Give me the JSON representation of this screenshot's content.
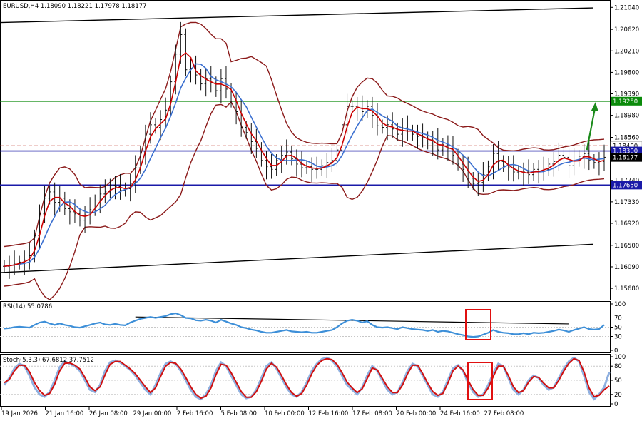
{
  "chart_data": {
    "type": "line",
    "header": "EURUSD,H4  1.18090 1.18221 1.17978 1.18177",
    "price_axis": {
      "ylim": [
        1.1545,
        1.2118
      ],
      "ticks": [
        "1.21040",
        "1.20620",
        "1.20210",
        "1.19800",
        "1.19390",
        "1.18980",
        "1.18560",
        "1.17740",
        "1.17330",
        "1.16920",
        "1.16500",
        "1.16090",
        "1.15680"
      ],
      "tick_values": [
        1.2104,
        1.2062,
        1.2021,
        1.198,
        1.1939,
        1.1898,
        1.1856,
        1.1774,
        1.1733,
        1.1692,
        1.165,
        1.1609,
        1.1568
      ]
    },
    "levels": [
      {
        "label": "1.19250",
        "value": 1.1925,
        "color": "#0a8a0a",
        "bg": "#0a8a0a",
        "fg": "#ffffff"
      },
      {
        "label": "1.18400",
        "value": 1.184,
        "color": "#c0392b",
        "bg": "#ffffff",
        "fg": "#000000",
        "dashed": true
      },
      {
        "label": "1.18300",
        "value": 1.183,
        "color": "#1a1aa8",
        "bg": "#1a1aa8",
        "fg": "#ffffff"
      },
      {
        "label": "1.18177",
        "value": 1.18177,
        "color": "#000000",
        "bg": "#000000",
        "fg": "#ffffff"
      },
      {
        "label": "1.17650",
        "value": 1.1765,
        "color": "#1a1aa8",
        "bg": "#1a1aa8",
        "fg": "#ffffff"
      }
    ],
    "x_axis": {
      "labels": [
        "19 Jan 2026",
        "21 Jan 16:00",
        "26 Jan 08:00",
        "29 Jan 00:00",
        "2 Feb 16:00",
        "5 Feb 08:00",
        "10 Feb 00:00",
        "12 Feb 16:00",
        "17 Feb 08:00",
        "20 Feb 00:00",
        "24 Feb 16:00",
        "27 Feb 08:00"
      ],
      "n_bars": 120
    },
    "price_series": [
      1.161,
      1.1612,
      1.1616,
      1.1618,
      1.1622,
      1.163,
      1.1668,
      1.171,
      1.174,
      1.1752,
      1.1732,
      1.174,
      1.172,
      1.1714,
      1.171,
      1.1698,
      1.1708,
      1.1718,
      1.1735,
      1.1748,
      1.1752,
      1.1765,
      1.1762,
      1.1755,
      1.1758,
      1.1768,
      1.1798,
      1.1828,
      1.1862,
      1.188,
      1.1875,
      1.189,
      1.1908,
      1.1962,
      1.2015,
      1.2052,
      1.1985,
      1.1988,
      1.1975,
      1.1958,
      1.1968,
      1.196,
      1.1945,
      1.1968,
      1.1948,
      1.1925,
      1.1905,
      1.1875,
      1.1865,
      1.1848,
      1.1835,
      1.1812,
      1.18,
      1.1795,
      1.1812,
      1.1822,
      1.1828,
      1.1815,
      1.1805,
      1.1798,
      1.18,
      1.1795,
      1.1795,
      1.1802,
      1.1808,
      1.1812,
      1.1832,
      1.188,
      1.1915,
      1.1915,
      1.1912,
      1.1905,
      1.1915,
      1.1898,
      1.1878,
      1.1875,
      1.188,
      1.1872,
      1.1862,
      1.1874,
      1.1868,
      1.1862,
      1.1858,
      1.1855,
      1.1845,
      1.185,
      1.1832,
      1.1842,
      1.1835,
      1.1822,
      1.1805,
      1.1795,
      1.1778,
      1.1768,
      1.177,
      1.1785,
      1.18,
      1.1825,
      1.181,
      1.1802,
      1.1798,
      1.179,
      1.1788,
      1.179,
      1.1785,
      1.1795,
      1.1792,
      1.1795,
      1.1805,
      1.181,
      1.1822,
      1.1818,
      1.1802,
      1.1812,
      1.182,
      1.1825,
      1.1812,
      1.1808,
      1.181,
      1.1818
    ],
    "overlays": [
      {
        "name": "fast MA",
        "color": "#cc0000"
      },
      {
        "name": "slow MA",
        "color": "#3a6fd0"
      },
      {
        "name": "Bollinger bands",
        "color": "#8b1a1a"
      }
    ],
    "trend_lines": [
      {
        "from": [
          0,
          1.2075
        ],
        "to": [
          119,
          1.2103
        ]
      },
      {
        "from": [
          0,
          1.1598
        ],
        "to": [
          119,
          1.1652
        ]
      }
    ],
    "arrow": {
      "from_bar": 115,
      "from_value": 1.1832,
      "to_bar": 116,
      "to_value": 1.1926,
      "color": "#1a8a1a"
    },
    "rsi": {
      "label": "RSI(14) 55.0786",
      "ylim": [
        0,
        100
      ],
      "ticks": [
        "100",
        "70",
        "50",
        "30",
        "0"
      ],
      "tick_values": [
        100,
        70,
        50,
        30,
        0
      ],
      "values": [
        47,
        48,
        50,
        51,
        50,
        49,
        55,
        60,
        62,
        58,
        55,
        58,
        55,
        53,
        50,
        49,
        52,
        55,
        58,
        60,
        56,
        55,
        57,
        55,
        54,
        60,
        64,
        68,
        70,
        72,
        70,
        72,
        74,
        78,
        80,
        76,
        70,
        69,
        65,
        64,
        66,
        64,
        60,
        66,
        62,
        58,
        55,
        50,
        48,
        45,
        43,
        40,
        38,
        38,
        40,
        42,
        44,
        41,
        40,
        39,
        40,
        38,
        38,
        40,
        42,
        44,
        50,
        58,
        64,
        66,
        64,
        60,
        63,
        55,
        50,
        49,
        50,
        48,
        46,
        50,
        48,
        46,
        45,
        44,
        42,
        44,
        40,
        42,
        41,
        38,
        35,
        33,
        30,
        29,
        30,
        34,
        38,
        44,
        40,
        38,
        37,
        35,
        35,
        37,
        35,
        38,
        37,
        38,
        40,
        42,
        45,
        43,
        40,
        44,
        47,
        50,
        46,
        45,
        46,
        55
      ],
      "trend_line": {
        "from": [
          26,
          72
        ],
        "to": [
          112,
          57
        ]
      }
    },
    "stochastic": {
      "label": "Stoch(5,3,3) 67.6812 37.7512",
      "ylim": [
        0,
        100
      ],
      "ticks": [
        "100",
        "80",
        "50",
        "20",
        "0"
      ],
      "tick_values": [
        100,
        80,
        50,
        20,
        0
      ],
      "main": [
        40,
        55,
        75,
        85,
        80,
        60,
        35,
        20,
        15,
        25,
        50,
        78,
        90,
        85,
        80,
        70,
        50,
        30,
        25,
        40,
        70,
        88,
        92,
        88,
        80,
        72,
        60,
        45,
        30,
        20,
        40,
        65,
        85,
        90,
        85,
        70,
        50,
        30,
        15,
        10,
        20,
        40,
        70,
        88,
        80,
        60,
        40,
        20,
        12,
        15,
        30,
        55,
        80,
        88,
        75,
        55,
        35,
        20,
        15,
        25,
        45,
        70,
        85,
        95,
        98,
        92,
        80,
        60,
        40,
        30,
        20,
        35,
        60,
        80,
        70,
        50,
        30,
        20,
        25,
        45,
        70,
        85,
        80,
        60,
        40,
        20,
        15,
        25,
        50,
        75,
        82,
        70,
        45,
        25,
        15,
        20,
        40,
        65,
        85,
        80,
        55,
        30,
        20,
        30,
        50,
        60,
        55,
        40,
        30,
        35,
        55,
        75,
        90,
        98,
        90,
        60,
        25,
        10,
        20,
        35,
        67
      ],
      "signal": [
        45,
        52,
        70,
        82,
        82,
        68,
        45,
        28,
        18,
        22,
        42,
        70,
        86,
        87,
        82,
        74,
        56,
        36,
        28,
        36,
        62,
        84,
        90,
        90,
        82,
        74,
        64,
        50,
        36,
        24,
        34,
        58,
        80,
        88,
        86,
        74,
        56,
        36,
        20,
        12,
        16,
        34,
        62,
        84,
        82,
        66,
        46,
        26,
        14,
        14,
        26,
        48,
        74,
        86,
        78,
        60,
        40,
        24,
        16,
        22,
        40,
        64,
        82,
        92,
        96,
        94,
        84,
        66,
        46,
        34,
        24,
        32,
        54,
        76,
        72,
        54,
        36,
        24,
        24,
        40,
        64,
        82,
        82,
        64,
        44,
        26,
        18,
        22,
        44,
        70,
        80,
        72,
        50,
        30,
        18,
        18,
        34,
        58,
        80,
        80,
        60,
        36,
        24,
        28,
        46,
        58,
        56,
        44,
        34,
        34,
        50,
        70,
        86,
        96,
        92,
        68,
        34,
        15,
        18,
        30,
        38
      ]
    }
  }
}
